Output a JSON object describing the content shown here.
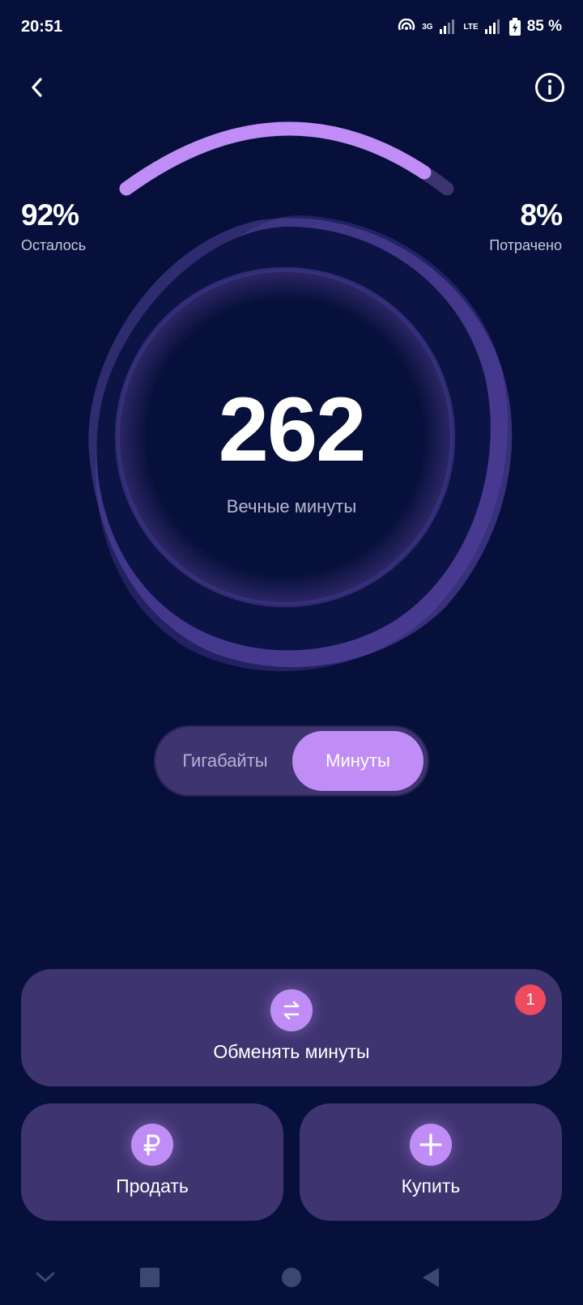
{
  "status_bar": {
    "time": "20:51",
    "network_3g": "3G",
    "network_lte": "LTE",
    "battery": "85 %"
  },
  "header": {
    "back_icon": "chevron-left-icon",
    "info_icon": "info-icon"
  },
  "gauge": {
    "remaining_fraction": 0.92,
    "remaining_value": "92%",
    "remaining_label": "Осталось",
    "spent_value": "8%",
    "spent_label": "Потрачено",
    "fill_color": "#bf8df5",
    "track_color": "#3b3470"
  },
  "balance": {
    "value": "262",
    "label": "Вечные минуты"
  },
  "toggle": {
    "options": [
      "Гигабайты",
      "Минуты"
    ],
    "selected": "Минуты"
  },
  "actions": {
    "exchange": {
      "label": "Обменять минуты",
      "icon": "swap-arrows-icon",
      "badge": "1"
    },
    "sell": {
      "label": "Продать",
      "icon": "ruble-icon"
    },
    "buy": {
      "label": "Купить",
      "icon": "plus-icon"
    }
  },
  "colors": {
    "background": "#06103a",
    "card": "#3e3470",
    "accent": "#bf8df5",
    "badge": "#f04a5e"
  }
}
